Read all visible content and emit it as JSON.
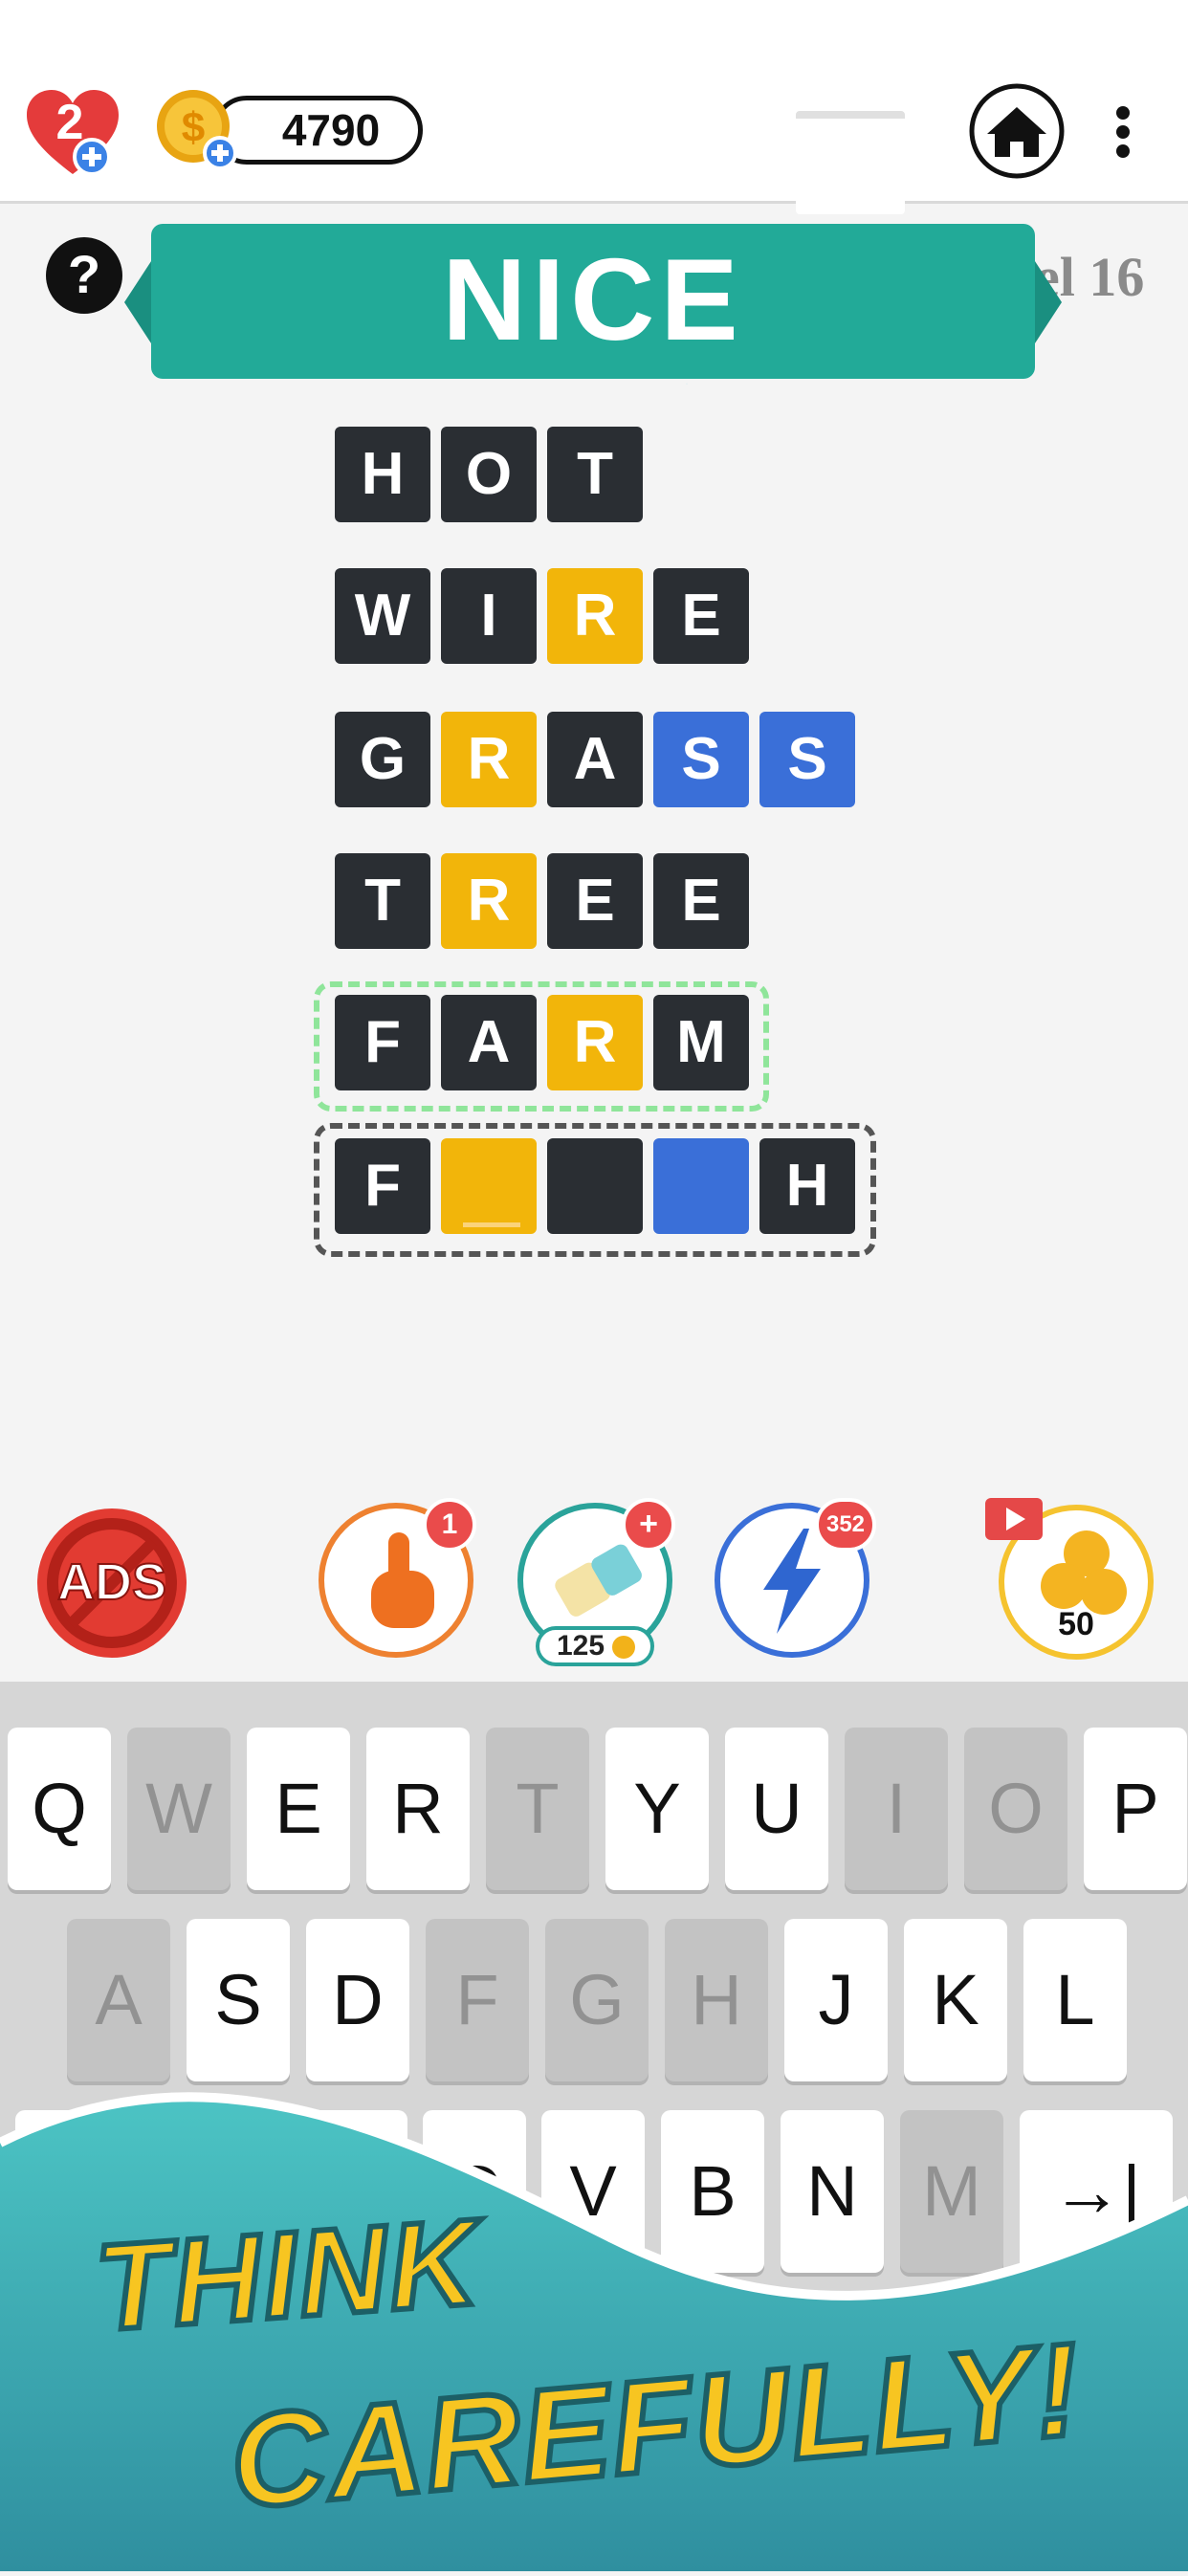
{
  "header": {
    "lives": "2",
    "coins": "4790"
  },
  "banner": {
    "title": "NICE",
    "level": "el 16"
  },
  "board": {
    "rows": [
      {
        "letters": [
          "H",
          "O",
          "T"
        ],
        "colors": [
          "dark",
          "dark",
          "dark"
        ]
      },
      {
        "letters": [
          "W",
          "I",
          "R",
          "E"
        ],
        "colors": [
          "dark",
          "dark",
          "yellow",
          "dark"
        ]
      },
      {
        "letters": [
          "G",
          "R",
          "A",
          "S",
          "S"
        ],
        "colors": [
          "dark",
          "yellow",
          "dark",
          "blue",
          "blue"
        ]
      },
      {
        "letters": [
          "T",
          "R",
          "E",
          "E"
        ],
        "colors": [
          "dark",
          "yellow",
          "dark",
          "dark"
        ]
      },
      {
        "letters": [
          "F",
          "A",
          "R",
          "M"
        ],
        "colors": [
          "dark",
          "dark",
          "yellow",
          "dark"
        ]
      },
      {
        "letters": [
          "F",
          "",
          "",
          "",
          "H"
        ],
        "colors": [
          "dark",
          "yellow",
          "dark",
          "blue",
          "dark"
        ]
      }
    ]
  },
  "powerups": {
    "ads_label": "ADS",
    "hint_count": "1",
    "eraser_badge": "+",
    "eraser_cost": "125",
    "bolt_count": "352",
    "reward_amount": "50"
  },
  "keyboard": {
    "row1": [
      {
        "key": "Q",
        "used": false
      },
      {
        "key": "W",
        "used": true
      },
      {
        "key": "E",
        "used": false
      },
      {
        "key": "R",
        "used": false
      },
      {
        "key": "T",
        "used": true
      },
      {
        "key": "Y",
        "used": false
      },
      {
        "key": "U",
        "used": false
      },
      {
        "key": "I",
        "used": true
      },
      {
        "key": "O",
        "used": true
      },
      {
        "key": "P",
        "used": false
      }
    ],
    "row2": [
      {
        "key": "A",
        "used": true
      },
      {
        "key": "S",
        "used": false
      },
      {
        "key": "D",
        "used": false
      },
      {
        "key": "F",
        "used": true
      },
      {
        "key": "G",
        "used": true
      },
      {
        "key": "H",
        "used": true
      },
      {
        "key": "J",
        "used": false
      },
      {
        "key": "K",
        "used": false
      },
      {
        "key": "L",
        "used": false
      }
    ],
    "row3": [
      {
        "key": "",
        "used": false
      },
      {
        "key": "",
        "used": false
      },
      {
        "key": "",
        "used": false
      },
      {
        "key": "C",
        "used": false
      },
      {
        "key": "V",
        "used": false
      },
      {
        "key": "B",
        "used": false
      },
      {
        "key": "N",
        "used": false
      },
      {
        "key": "M",
        "used": true
      },
      {
        "key": "→|",
        "used": false
      }
    ]
  },
  "promo": {
    "line1": "THINK",
    "line2": "CAREFULLY!"
  },
  "colors": {
    "dark": "#2a2e33",
    "yellow": "#f2b50a",
    "blue": "#3a6fd8",
    "banner": "#22aa98",
    "accent_red": "#ea4b4b"
  }
}
